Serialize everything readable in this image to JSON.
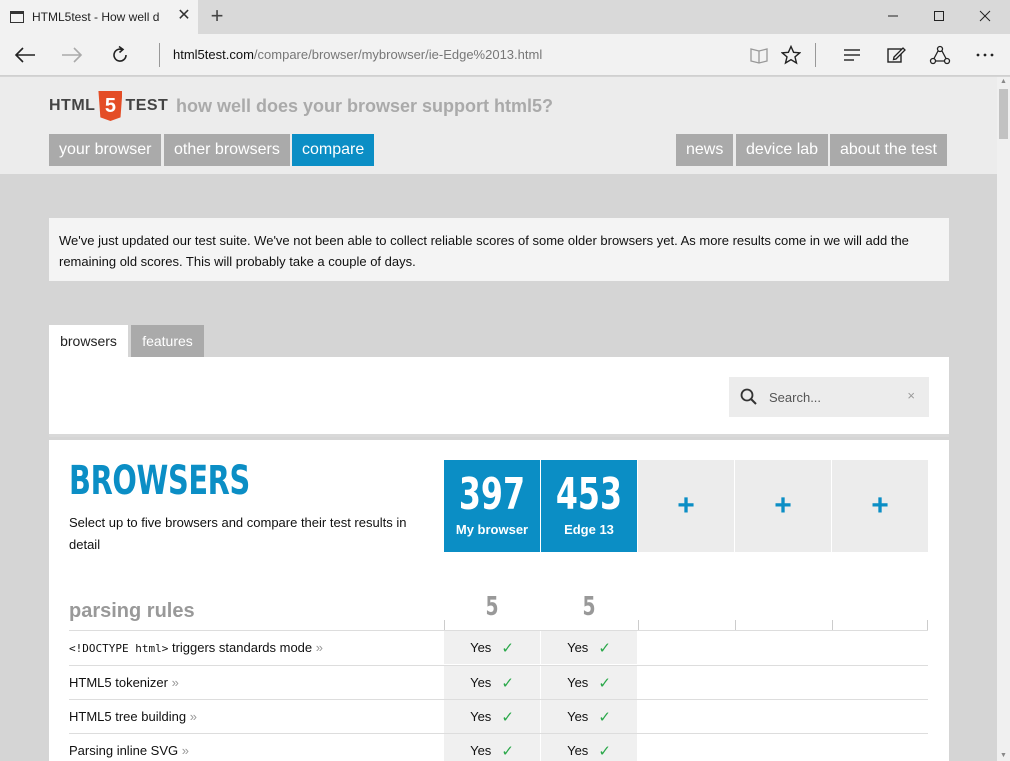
{
  "browser": {
    "tab_title": "HTML5test - How well d",
    "tab_close": "✕",
    "new_tab": "+",
    "address_host": "html5test.com",
    "address_path": "/compare/browser/mybrowser/ie-Edge%2013.html"
  },
  "site": {
    "logo_left": "HTML",
    "logo_mid": "5",
    "logo_right": "TEST",
    "tagline": "how well does your browser support html5?",
    "menu_left": [
      "your browser",
      "other browsers",
      "compare"
    ],
    "menu_right": [
      "news",
      "device lab",
      "about the test"
    ],
    "active_menu": "compare"
  },
  "notice": "We've just updated our test suite. We've not been able to collect reliable scores of some older browsers yet. As more results come in we will add the remaining old scores. This will probably take a couple of days.",
  "tabs": {
    "browsers": "browsers",
    "features": "features"
  },
  "search": {
    "placeholder": "Search...",
    "clear": "×"
  },
  "compare": {
    "title": "BROWSERS",
    "description": "Select up to five browsers and compare their test results in detail",
    "columns": [
      {
        "score": "397",
        "label": "My browser"
      },
      {
        "score": "453",
        "label": "Edge 13"
      },
      {
        "add": "+"
      },
      {
        "add": "+"
      },
      {
        "add": "+"
      }
    ]
  },
  "section": {
    "title": "parsing rules",
    "scores": [
      "5",
      "5"
    ],
    "more": "»",
    "rows": [
      {
        "code": "<!DOCTYPE html>",
        "label": " triggers standards mode",
        "values": [
          "Yes",
          "Yes"
        ]
      },
      {
        "code": "",
        "label": "HTML5 tokenizer",
        "values": [
          "Yes",
          "Yes"
        ]
      },
      {
        "code": "",
        "label": "HTML5 tree building",
        "values": [
          "Yes",
          "Yes"
        ]
      },
      {
        "code": "",
        "label": "Parsing inline SVG",
        "values": [
          "Yes",
          "Yes"
        ]
      }
    ]
  },
  "colors": {
    "accent": "#0b8ec5",
    "logo": "#e44d26",
    "check": "#2aa84a"
  }
}
